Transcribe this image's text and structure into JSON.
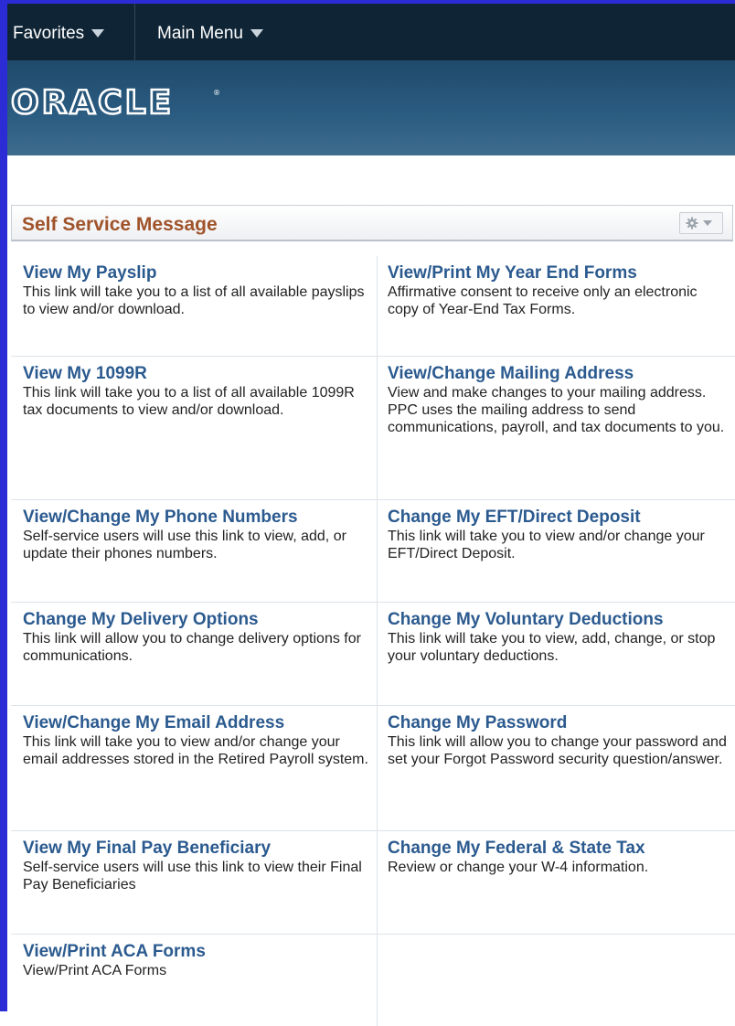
{
  "nav": {
    "favorites": "Favorites",
    "main_menu": "Main Menu"
  },
  "brand": {
    "logo_text": "ORACLE"
  },
  "pagelet": {
    "title": "Self Service Message"
  },
  "links": [
    {
      "title": "View My Payslip",
      "desc": "This link will take you to a list of all available payslips to view and/or download."
    },
    {
      "title": "View/Print My Year End Forms",
      "desc": "Affirmative consent to receive only an electronic copy of Year-End Tax Forms."
    },
    {
      "title": "View My 1099R",
      "desc": "This link will take you to a list of all available 1099R tax documents to view and/or download."
    },
    {
      "title": "View/Change Mailing Address",
      "desc": "View and make changes to your mailing address. PPC uses the mailing address to send communications, payroll, and tax documents to you."
    },
    {
      "title": "View/Change My Phone Numbers",
      "desc": "Self-service users will use this link to view, add, or update their phones numbers."
    },
    {
      "title": "Change My EFT/Direct Deposit",
      "desc": "This link will take you to view and/or change your EFT/Direct Deposit."
    },
    {
      "title": "Change My Delivery Options",
      "desc": "This link will allow you to change delivery options for communications."
    },
    {
      "title": "Change My Voluntary Deductions",
      "desc": "This link will take you to view, add, change, or stop your voluntary deductions."
    },
    {
      "title": "View/Change My Email Address",
      "desc": "This link will take you to view and/or change your email addresses stored in the Retired Payroll system."
    },
    {
      "title": "Change My Password",
      "desc": "This link will allow you to change your password and set your Forgot Password security question/answer."
    },
    {
      "title": "View My Final Pay Beneficiary",
      "desc": "Self-service users will use this link to view their Final Pay Beneficiaries"
    },
    {
      "title": "Change My Federal & State Tax",
      "desc": "Review or change your W-4 information."
    },
    {
      "title": "View/Print ACA Forms",
      "desc": "View/Print ACA Forms"
    }
  ]
}
